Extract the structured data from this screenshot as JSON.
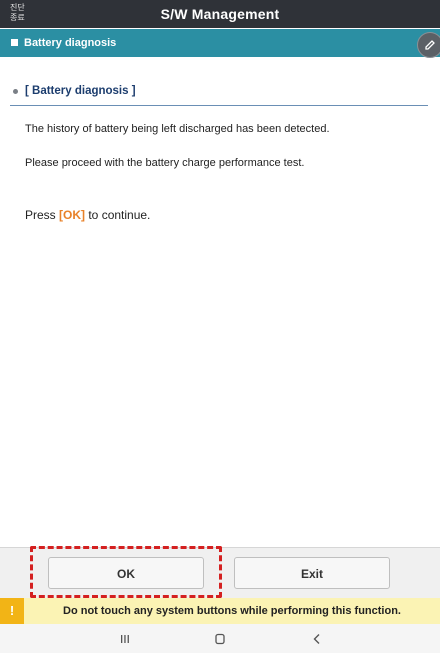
{
  "titlebar": {
    "end_diagnosis_line1": "진단",
    "end_diagnosis_line2": "종료",
    "title": "S/W Management"
  },
  "section": {
    "title": "Battery diagnosis",
    "edit_icon": "pencil-icon"
  },
  "content": {
    "sub_heading": "[ Battery diagnosis ]",
    "message_1": "The history of battery being left discharged has been detected.",
    "message_2": "Please proceed with the battery charge performance test.",
    "press_prefix": "Press ",
    "press_key": "[OK]",
    "press_suffix": " to continue."
  },
  "buttons": {
    "ok_label": "OK",
    "exit_label": "Exit"
  },
  "warning": {
    "icon": "!",
    "text": "Do not touch any system buttons while performing this function."
  },
  "navbar": {
    "recent_icon": "recent-apps-icon",
    "home_icon": "home-icon",
    "back_icon": "back-icon"
  },
  "colors": {
    "title_bar": "#2f3238",
    "section_header": "#2b8fa3",
    "highlight": "#e8822a",
    "warning_bg": "#fbf3b4",
    "warning_icon": "#f2b416",
    "annotation": "#d42020"
  }
}
